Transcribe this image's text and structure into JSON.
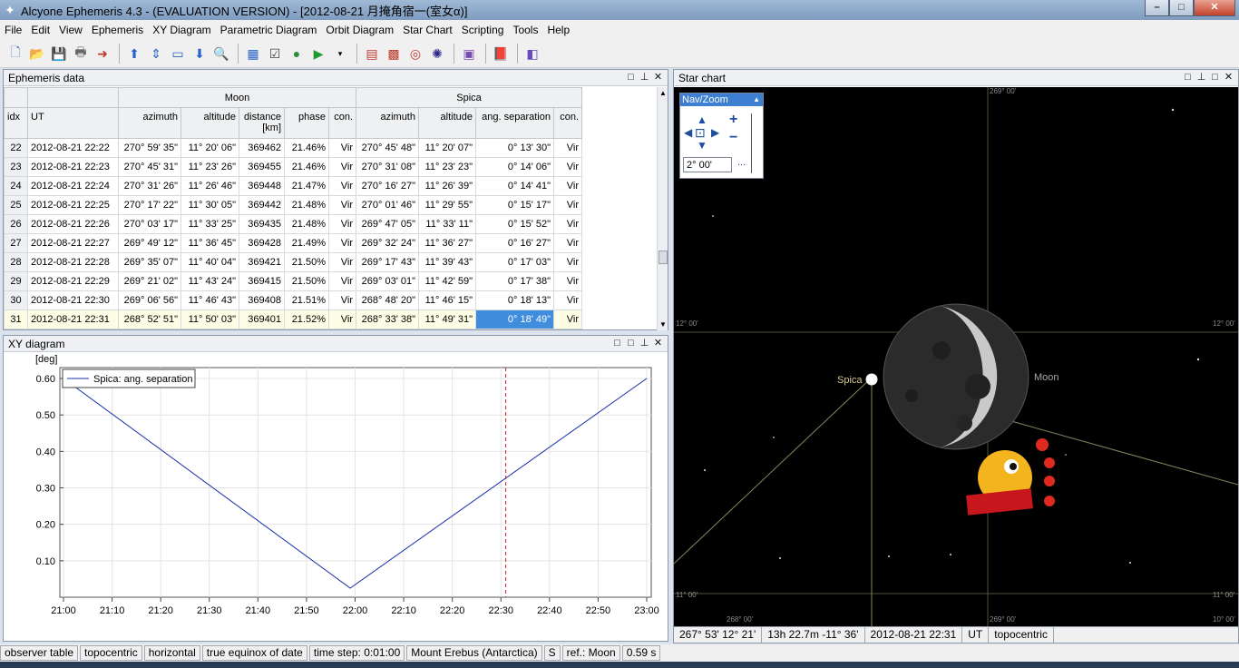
{
  "window": {
    "title": "Alcyone Ephemeris 4.3 - (EVALUATION VERSION) - [2012-08-21 月掩角宿一(室女α)]"
  },
  "menu": [
    "File",
    "Edit",
    "View",
    "Ephemeris",
    "XY Diagram",
    "Parametric Diagram",
    "Orbit Diagram",
    "Star Chart",
    "Scripting",
    "Tools",
    "Help"
  ],
  "ephemeris": {
    "title": "Ephemeris data",
    "group_moon": "Moon",
    "group_spica": "Spica",
    "headers": [
      "idx",
      "UT",
      "azimuth",
      "altitude",
      "distance\n[km]",
      "phase",
      "con.",
      "azimuth",
      "altitude",
      "ang. separation",
      "con."
    ],
    "rows": [
      [
        "22",
        "2012-08-21  22:22",
        "270° 59' 35\"",
        "11° 20' 06\"",
        "369462",
        "21.46%",
        "Vir",
        "270° 45' 48\"",
        "11° 20' 07\"",
        "0° 13' 30\"",
        "Vir"
      ],
      [
        "23",
        "2012-08-21  22:23",
        "270° 45' 31\"",
        "11° 23' 26\"",
        "369455",
        "21.46%",
        "Vir",
        "270° 31' 08\"",
        "11° 23' 23\"",
        "0° 14' 06\"",
        "Vir"
      ],
      [
        "24",
        "2012-08-21  22:24",
        "270° 31' 26\"",
        "11° 26' 46\"",
        "369448",
        "21.47%",
        "Vir",
        "270° 16' 27\"",
        "11° 26' 39\"",
        "0° 14' 41\"",
        "Vir"
      ],
      [
        "25",
        "2012-08-21  22:25",
        "270° 17' 22\"",
        "11° 30' 05\"",
        "369442",
        "21.48%",
        "Vir",
        "270° 01' 46\"",
        "11° 29' 55\"",
        "0° 15' 17\"",
        "Vir"
      ],
      [
        "26",
        "2012-08-21  22:26",
        "270° 03' 17\"",
        "11° 33' 25\"",
        "369435",
        "21.48%",
        "Vir",
        "269° 47' 05\"",
        "11° 33' 11\"",
        "0° 15' 52\"",
        "Vir"
      ],
      [
        "27",
        "2012-08-21  22:27",
        "269° 49' 12\"",
        "11° 36' 45\"",
        "369428",
        "21.49%",
        "Vir",
        "269° 32' 24\"",
        "11° 36' 27\"",
        "0° 16' 27\"",
        "Vir"
      ],
      [
        "28",
        "2012-08-21  22:28",
        "269° 35' 07\"",
        "11° 40' 04\"",
        "369421",
        "21.50%",
        "Vir",
        "269° 17' 43\"",
        "11° 39' 43\"",
        "0° 17' 03\"",
        "Vir"
      ],
      [
        "29",
        "2012-08-21  22:29",
        "269° 21' 02\"",
        "11° 43' 24\"",
        "369415",
        "21.50%",
        "Vir",
        "269° 03' 01\"",
        "11° 42' 59\"",
        "0° 17' 38\"",
        "Vir"
      ],
      [
        "30",
        "2012-08-21  22:30",
        "269° 06' 56\"",
        "11° 46' 43\"",
        "369408",
        "21.51%",
        "Vir",
        "268° 48' 20\"",
        "11° 46' 15\"",
        "0° 18' 13\"",
        "Vir"
      ],
      [
        "31",
        "2012-08-21  22:31",
        "268° 52' 51\"",
        "11° 50' 03\"",
        "369401",
        "21.52%",
        "Vir",
        "268° 33' 38\"",
        "11° 49' 31\"",
        "0° 18' 49\"",
        "Vir"
      ]
    ]
  },
  "xy": {
    "title": "XY diagram",
    "unit": "[deg]",
    "legend": "Spica: ang. separation",
    "series_color": "#1a2fa8",
    "marker_color": "#c0262c"
  },
  "chart_data": {
    "type": "line",
    "ylabel": "[deg]",
    "ylim": [
      0.02,
      0.6
    ],
    "yticks": [
      "0.60",
      "0.50",
      "0.40",
      "0.30",
      "0.20",
      "0.10"
    ],
    "xticks": [
      "21:00",
      "21:10",
      "21:20",
      "21:30",
      "21:40",
      "21:50",
      "22:00",
      "22:10",
      "22:20",
      "22:30",
      "22:40",
      "22:50",
      "23:00"
    ],
    "series": [
      {
        "name": "Spica: ang. separation",
        "x": [
          "21:00",
          "21:59",
          "23:00"
        ],
        "values": [
          0.6,
          0.025,
          0.6
        ]
      }
    ],
    "marker_x": "22:31"
  },
  "star": {
    "title": "Star chart",
    "navzoom_title": "Nav/Zoom",
    "fov": "2° 00'",
    "more": "...",
    "label_spica": "Spica",
    "label_moon": "Moon",
    "grid_labels": [
      "269° 00'",
      "12° 00'",
      "12° 00'",
      "11° 00'",
      "11° 00'",
      "268° 00'",
      "269° 00'",
      "10° 00'"
    ],
    "status": [
      "267° 53'   12° 21'",
      "13h 22.7m   -11° 36'",
      "2012-08-21  22:31",
      "UT",
      "topocentric"
    ]
  },
  "statusbar": [
    "observer table",
    "topocentric",
    "horizontal",
    "true equinox of date",
    "time step: 0:01:00",
    "Mount Erebus (Antarctica)",
    "S",
    "ref.: Moon",
    "0.59 s"
  ],
  "colors": {
    "sky": "#000000",
    "grid": "#55513a",
    "selection": "#3f8ddc"
  }
}
